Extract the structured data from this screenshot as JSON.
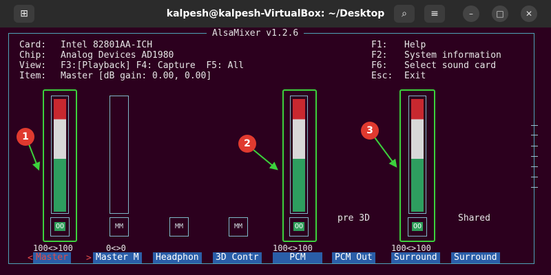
{
  "window": {
    "title": "kalpesh@kalpesh-VirtualBox: ~/Desktop",
    "new_tab_icon": "new-tab-icon",
    "search_icon": "search-icon",
    "menu_icon": "hamburger-menu-icon",
    "minimize": "–",
    "maximize": "□",
    "close": "✕"
  },
  "mixer": {
    "title": "AlsaMixer v1.2.6",
    "info": {
      "card_label": "Card:",
      "card": "Intel 82801AA-ICH",
      "chip_label": "Chip:",
      "chip": "Analog Devices AD1980",
      "view_label": "View:",
      "view": "F3:[Playback] F4: Capture  F5: All",
      "item_label": "Item:",
      "item": "Master [dB gain: 0.00, 0.00]"
    },
    "help": [
      {
        "key": "F1:",
        "text": "Help"
      },
      {
        "key": "F2:",
        "text": "System information"
      },
      {
        "key": "F6:",
        "text": "Select sound card"
      },
      {
        "key": "Esc:",
        "text": "Exit"
      }
    ],
    "channels": [
      {
        "name": "Master",
        "level": "100<>100",
        "mute": "OO",
        "volume": 1.0,
        "highlighted": true,
        "selected": true
      },
      {
        "name": "Master M",
        "level": "0<>0",
        "mute": "MM",
        "volume": 0.0,
        "highlighted": false
      },
      {
        "name": "Headphon",
        "mute": "MM",
        "highlighted": false
      },
      {
        "name": "3D Contr",
        "mute": "MM",
        "highlighted": false
      },
      {
        "name": "PCM",
        "level": "100<>100",
        "mute": "OO",
        "volume": 1.0,
        "highlighted": true
      },
      {
        "name": "PCM Out",
        "label": "pre 3D"
      },
      {
        "name": "Surround",
        "level": "100<>100",
        "mute": "OO",
        "volume": 1.0,
        "highlighted": true
      },
      {
        "name": "Surround",
        "label": "Shared"
      }
    ],
    "selection_marks": {
      "left": "<",
      "right": ">"
    }
  },
  "annotations": [
    "1",
    "2",
    "3"
  ],
  "colors": {
    "background": "#2c001e",
    "bar_red": "#c8282f",
    "bar_white": "#d8d8d8",
    "bar_green": "#2e9e5f",
    "highlight": "#3cd23c",
    "badge": "#e03a2f",
    "channel_bg": "#2a5ea8"
  }
}
